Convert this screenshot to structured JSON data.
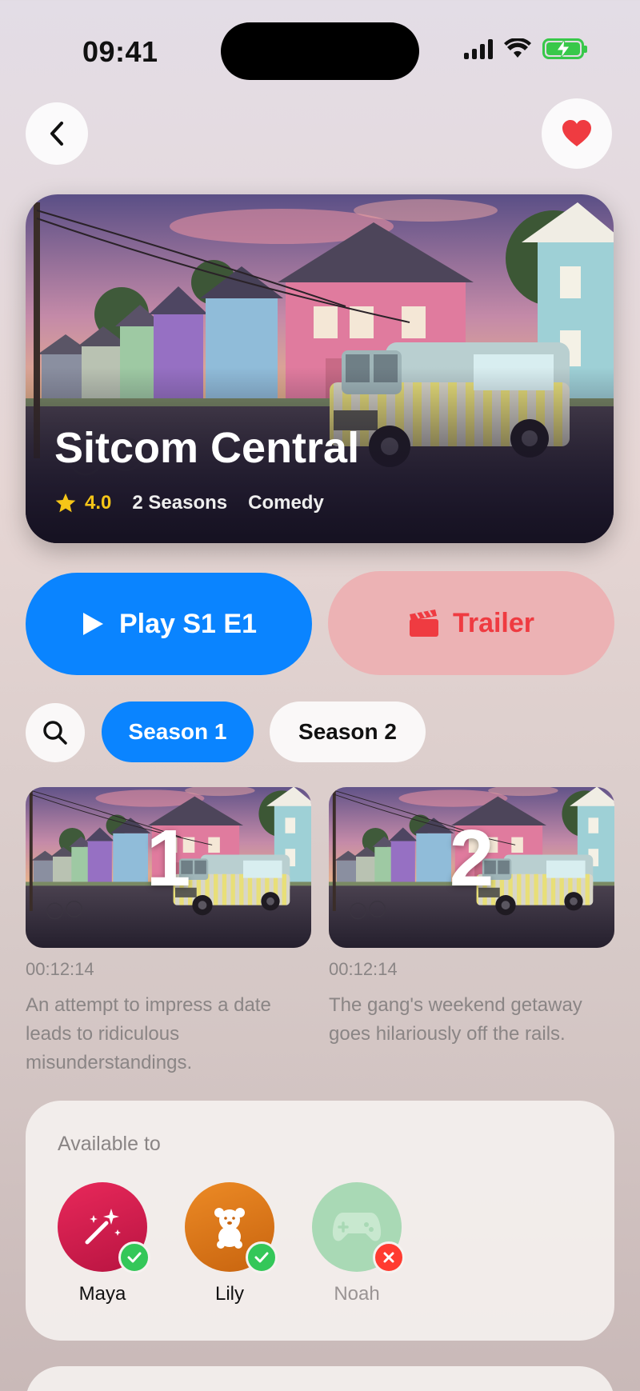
{
  "status_bar": {
    "time": "09:41"
  },
  "show": {
    "title": "Sitcom Central",
    "rating": "4.0",
    "seasons": "2 Seasons",
    "genre": "Comedy"
  },
  "actions": {
    "play_label": "Play S1 E1",
    "trailer_label": "Trailer"
  },
  "season_tabs": [
    "Season 1",
    "Season 2"
  ],
  "episodes": [
    {
      "number": "1",
      "duration": "00:12:14",
      "description": "An attempt to impress a date leads to ridiculous misunderstandings."
    },
    {
      "number": "2",
      "duration": "00:12:14",
      "description": "The gang's weekend getaway goes hilariously off the rails."
    }
  ],
  "availability": {
    "title": "Available to",
    "profiles": [
      {
        "name": "Maya",
        "icon": "magic-wand-icon",
        "color": "#d81b4a",
        "available": true
      },
      {
        "name": "Lily",
        "icon": "teddy-bear-icon",
        "color": "#e07a1c",
        "available": true
      },
      {
        "name": "Noah",
        "icon": "game-controller-icon",
        "color": "#a8d8b4",
        "available": false
      }
    ]
  },
  "colors": {
    "accent": "#0a84ff",
    "favorite": "#ef3b41",
    "rating": "#f5c518",
    "success": "#34c759",
    "error": "#ff3b30"
  }
}
